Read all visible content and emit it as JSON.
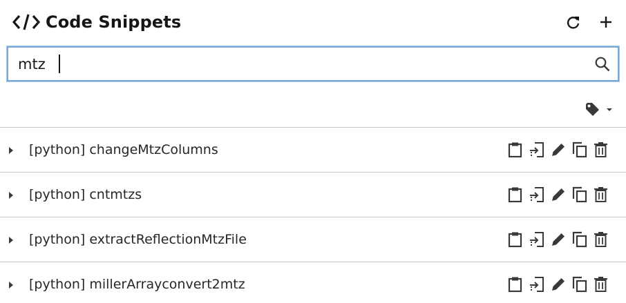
{
  "header": {
    "title": "Code Snippets",
    "icons": [
      "code-icon",
      "refresh-icon",
      "add-icon"
    ]
  },
  "search": {
    "value": "mtz",
    "icon": "search-icon"
  },
  "filter": {
    "icon": "tag-icon",
    "dropdown_icon": "caret-down-icon"
  },
  "snippets": [
    {
      "language": "[python]",
      "name": "changeMtzColumns"
    },
    {
      "language": "[python]",
      "name": "cntmtzs"
    },
    {
      "language": "[python]",
      "name": "extractReflectionMtzFile"
    },
    {
      "language": "[python]",
      "name": "millerArrayconvert2mtz"
    }
  ],
  "row_actions": [
    "copy-to-clipboard-icon",
    "insert-icon",
    "edit-icon",
    "duplicate-icon",
    "delete-icon"
  ],
  "colors": {
    "search_border": "#78a9d6",
    "text": "#161616",
    "divider": "#c6c6c6"
  }
}
